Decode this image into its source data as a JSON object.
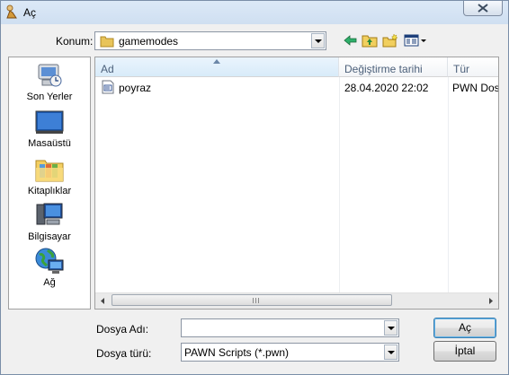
{
  "window": {
    "title": "Aç"
  },
  "toolbar": {
    "location_label": "Konum:",
    "location_value": "gamemodes",
    "icons": [
      "back-arrow-icon",
      "up-folder-icon",
      "new-folder-icon",
      "view-menu-icon"
    ]
  },
  "places": [
    {
      "label": "Son Yerler",
      "icon": "recent-places-icon"
    },
    {
      "label": "Masaüstü",
      "icon": "desktop-icon"
    },
    {
      "label": "Kitaplıklar",
      "icon": "libraries-icon"
    },
    {
      "label": "Bilgisayar",
      "icon": "computer-icon"
    },
    {
      "label": "Ağ",
      "icon": "network-icon"
    }
  ],
  "columns": [
    {
      "label": "Ad",
      "sorted": true
    },
    {
      "label": "Değiştirme tarihi"
    },
    {
      "label": "Tür"
    }
  ],
  "files": [
    {
      "name": "poyraz",
      "modified": "28.04.2020 22:02",
      "type": "PWN Dosyası"
    }
  ],
  "form": {
    "filename_label": "Dosya Adı:",
    "filename_value": "",
    "filetype_label": "Dosya türü:",
    "filetype_value": "PAWN Scripts (*.pwn)"
  },
  "buttons": {
    "open": "Aç",
    "cancel": "İptal"
  },
  "colors": {
    "title_bar": "#dce9f7",
    "header_text": "#4c607a",
    "default_button_border": "#3c7fb1"
  }
}
